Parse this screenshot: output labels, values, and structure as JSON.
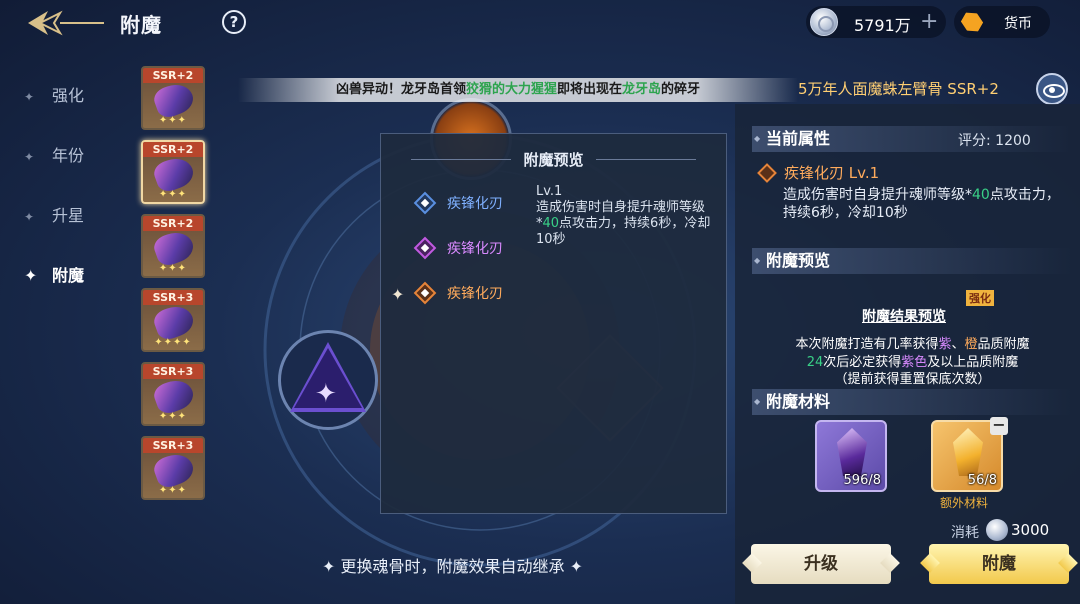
{
  "header": {
    "title": "附魔",
    "help_symbol": "?",
    "coins": "5791万",
    "coins_plus": "+",
    "currency_label": "货币"
  },
  "sidebar": {
    "tabs": [
      {
        "label": "强化",
        "active": false
      },
      {
        "label": "年份",
        "active": false
      },
      {
        "label": "升星",
        "active": false
      },
      {
        "label": "附魔",
        "active": true
      }
    ]
  },
  "slots": [
    {
      "grade": "SSR+2",
      "stars": "✦✦✦",
      "selected": false
    },
    {
      "grade": "SSR+2",
      "stars": "✦✦✦",
      "selected": true
    },
    {
      "grade": "SSR+2",
      "stars": "✦✦✦",
      "selected": false
    },
    {
      "grade": "SSR+3",
      "stars": "✦✦✦✦",
      "selected": false
    },
    {
      "grade": "SSR+3",
      "stars": "✦✦✦",
      "selected": false
    },
    {
      "grade": "SSR+3",
      "stars": "✦✦✦",
      "selected": false
    }
  ],
  "banner": {
    "part1": "凶兽异动！龙牙岛首领",
    "beast": "狡猾的大力猩猩",
    "part2": "即将出现在",
    "place": "龙牙岛",
    "part3": "的",
    "part4": "碎牙"
  },
  "item_name": "5万年人面魔蛛左臂骨 SSR+2",
  "popup": {
    "title": "附魔预览",
    "options": [
      {
        "label": "疾锋化刃",
        "color": "#7fb0ff"
      },
      {
        "label": "疾锋化刃",
        "color": "#d98aff"
      },
      {
        "label": "疾锋化刃",
        "color": "#ffab5c"
      }
    ],
    "level": "Lv.1",
    "desc_a": "造成伤害时自身提升魂师等级*",
    "desc_num": "40",
    "desc_b": "点攻击力，持续6秒，冷却10秒"
  },
  "hint": "✦ 更换魂骨时，附魔效果自动继承 ✦",
  "current_attr": {
    "heading": "当前属性",
    "score": "评分: 1200",
    "name": "疾锋化刃 Lv.1",
    "desc_a": "造成伤害时自身提升魂师等级*",
    "desc_num": "40",
    "desc_b": "点攻击力，持续6秒，冷却10秒"
  },
  "preview": {
    "heading": "附魔预览",
    "result_title": "附魔结果预览",
    "tag": "强化",
    "line1_a": "本次附魔打造有几率获得",
    "line1_pur": "紫",
    "line1_sep": "、",
    "line1_ora": "橙",
    "line1_b": "品质附魔",
    "line2_num": "24",
    "line2_a": "次后必定获得",
    "line2_pur": "紫色",
    "line2_b": "及以上品质附魔",
    "line3": "（提前获得重置保底次数）"
  },
  "materials": {
    "heading": "附魔材料",
    "items": [
      {
        "count": "596/8"
      },
      {
        "count": "56/8",
        "extra_label": "额外材料"
      }
    ],
    "minus": "−"
  },
  "cost": {
    "label": "消耗",
    "amount": "3000"
  },
  "buttons": {
    "upgrade": "升级",
    "enchant": "附魔"
  }
}
